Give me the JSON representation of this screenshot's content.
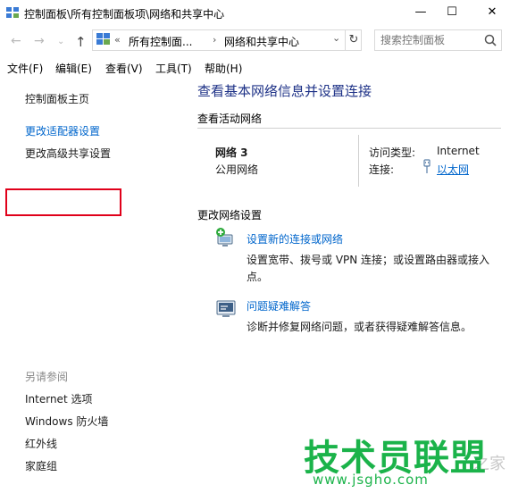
{
  "window": {
    "title": "控制面板\\所有控制面板项\\网络和共享中心",
    "minimize": "—",
    "maximize": "☐",
    "close": "✕"
  },
  "nav": {
    "back": "←",
    "forward": "→",
    "recent": "⌄",
    "up": "↑",
    "address_prefix": "«",
    "address_crumbs": [
      "所有控制面...",
      "网络和共享中心"
    ],
    "address_sep": "›",
    "address_dropdown": "⌄",
    "refresh": "↻",
    "search_placeholder": "搜索控制面板"
  },
  "menu": [
    "文件(F)",
    "编辑(E)",
    "查看(V)",
    "工具(T)",
    "帮助(H)"
  ],
  "left": {
    "home": "控制面板主页",
    "change_adapter": "更改适配器设置",
    "advanced_sharing": "更改高级共享设置",
    "see_also_title": "另请参阅",
    "see_also": [
      "Internet 选项",
      "Windows 防火墙",
      "红外线",
      "家庭组"
    ]
  },
  "main": {
    "heading": "查看基本网络信息并设置连接",
    "active_section": "查看活动网络",
    "network_name": "网络  3",
    "network_type": "公用网络",
    "access_type_label": "访问类型:",
    "access_type_value": "Internet",
    "connection_label": "连接:",
    "connection_value": "以太网",
    "change_section": "更改网络设置",
    "setup_link": "设置新的连接或网络",
    "setup_desc_line1": "设置宽带、拨号或 VPN 连接；或设置路由器或接入",
    "setup_desc_line2": "点。",
    "trouble_link": "问题疑难解答",
    "trouble_desc": "诊断并修复网络问题，或者获得疑难解答信息。"
  },
  "watermark": {
    "brand": "技术员联盟",
    "url": "www.jsgho.com",
    "faint": "之家"
  },
  "colors": {
    "accent_link": "#0066cc",
    "heading": "#1e3287",
    "highlight_box": "#e0001a",
    "watermark": "#1bb34a"
  }
}
